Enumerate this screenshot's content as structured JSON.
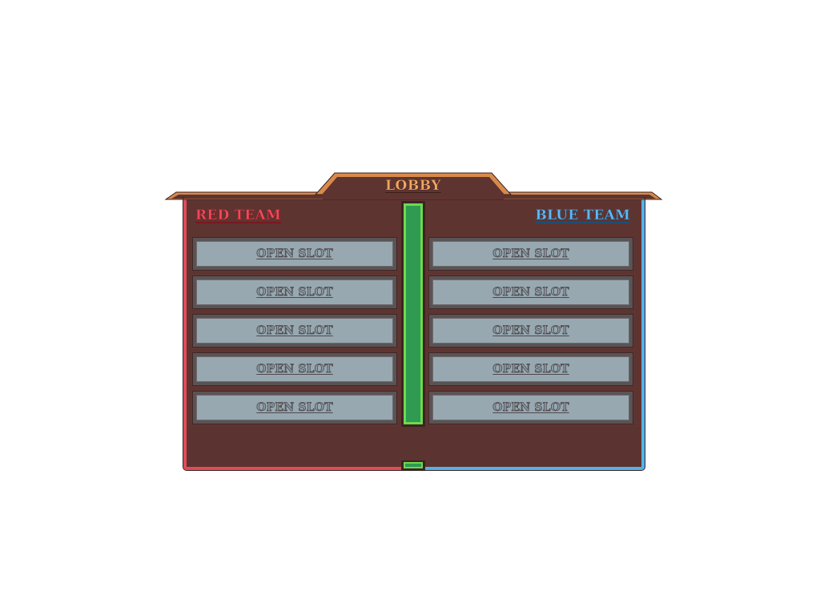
{
  "header": {
    "title": "LOBBY"
  },
  "teams": {
    "red": {
      "name": "RED TEAM",
      "color": "#e04c59",
      "slots": [
        {
          "label": "OPEN SLOT"
        },
        {
          "label": "OPEN SLOT"
        },
        {
          "label": "OPEN SLOT"
        },
        {
          "label": "OPEN SLOT"
        },
        {
          "label": "OPEN SLOT"
        }
      ]
    },
    "blue": {
      "name": "BLUE TEAM",
      "color": "#54b1e9",
      "slots": [
        {
          "label": "OPEN SLOT"
        },
        {
          "label": "OPEN SLOT"
        },
        {
          "label": "OPEN SLOT"
        },
        {
          "label": "OPEN SLOT"
        },
        {
          "label": "OPEN SLOT"
        }
      ]
    }
  },
  "colors": {
    "panel": "#5e3431",
    "header_trim": "#f0a860",
    "divider_fill": "#2e9a52",
    "divider_border": "#6ed94d",
    "slot_fill": "#97a8b1",
    "slot_border": "#5a5356"
  }
}
